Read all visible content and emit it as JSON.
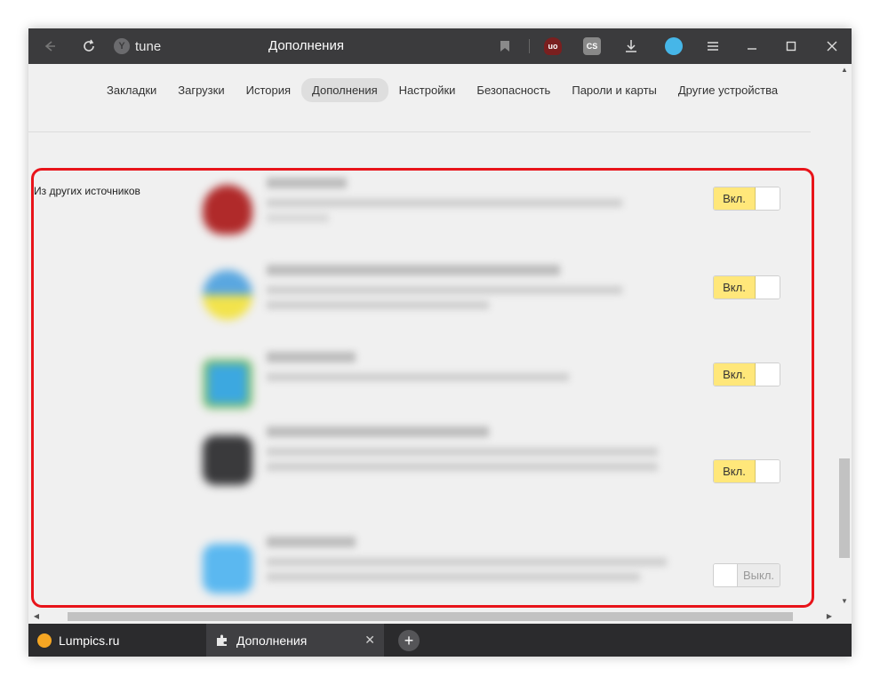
{
  "titlebar": {
    "address_text": "tune",
    "page_title": "Дополнения"
  },
  "nav": {
    "tabs": [
      {
        "label": "Закладки"
      },
      {
        "label": "Загрузки"
      },
      {
        "label": "История"
      },
      {
        "label": "Дополнения",
        "active": true
      },
      {
        "label": "Настройки"
      },
      {
        "label": "Безопасность"
      },
      {
        "label": "Пароли и карты"
      },
      {
        "label": "Другие устройства"
      }
    ]
  },
  "section": {
    "label": "Из других источников"
  },
  "extensions": [
    {
      "state_label": "Вкл.",
      "enabled": true,
      "logo_color": "#b02a2a"
    },
    {
      "state_label": "Вкл.",
      "enabled": true,
      "logo_color": "#5aa7e0"
    },
    {
      "state_label": "Вкл.",
      "enabled": true,
      "logo_color": "#3ca8e0"
    },
    {
      "state_label": "Вкл.",
      "enabled": true,
      "logo_color": "#3a3a3c"
    },
    {
      "state_label": "Выкл.",
      "enabled": false,
      "logo_color": "#5bb8f0"
    }
  ],
  "tabs": [
    {
      "label": "Lumpics.ru",
      "icon_color": "#f5a623"
    },
    {
      "label": "Дополнения",
      "active": true,
      "close_glyph": "✕"
    }
  ],
  "newtab_glyph": "+",
  "colors": {
    "accent_on": "#ffe77a",
    "highlight": "#e8141a",
    "titlebar": "#3b3b3d"
  }
}
